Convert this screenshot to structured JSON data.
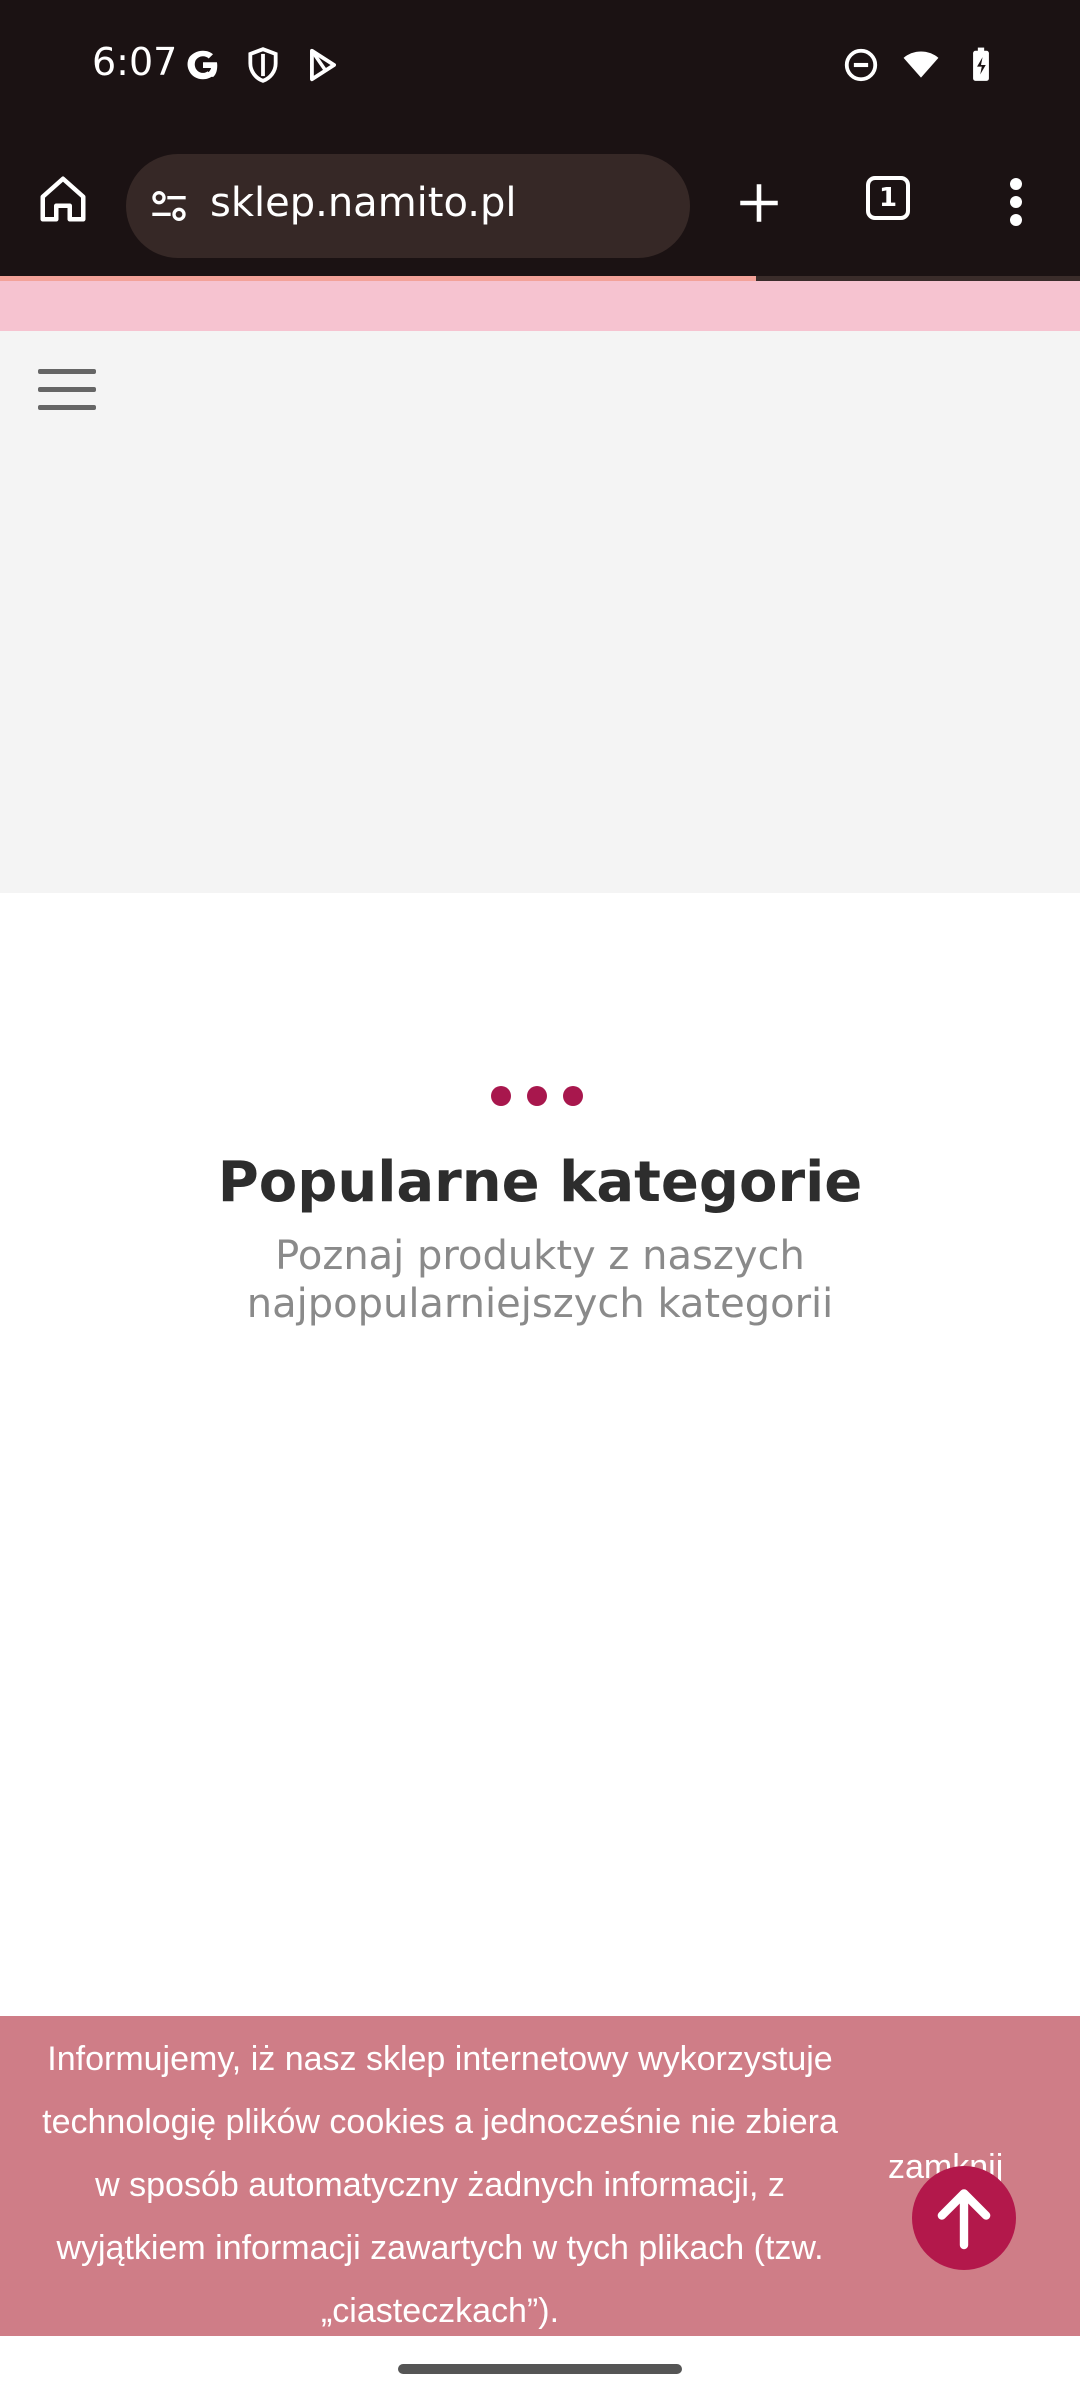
{
  "status_bar": {
    "time": "6:07",
    "left_icons": [
      "google-icon",
      "shield-icon",
      "play-store-icon"
    ],
    "right_icons": [
      "dnd-icon",
      "wifi-icon",
      "battery-icon"
    ]
  },
  "browser": {
    "url": "sklep.namito.pl",
    "tab_count": "1",
    "load_progress": 0.7,
    "accent_progress_color": "#f3a299"
  },
  "section": {
    "title": "Popularne kategorie",
    "subtitle": "Poznaj produkty z naszych najpopularniejszych kategorii"
  },
  "cookie_banner": {
    "lines": [
      "Informujemy, iż nasz sklep internetowy wykorzystuje",
      "technologię plików cookies a jednocześnie nie zbiera",
      "w sposób automatyczny żadnych informacji, z",
      "wyjątkiem informacji zawartych w tych plikach (tzw.",
      "„ciasteczkach”)."
    ],
    "close_label": "zamknij"
  },
  "colors": {
    "brand": "#a8174d",
    "cookie_bg": "#cf7d87",
    "pink_strip": "#f6c3d0"
  }
}
